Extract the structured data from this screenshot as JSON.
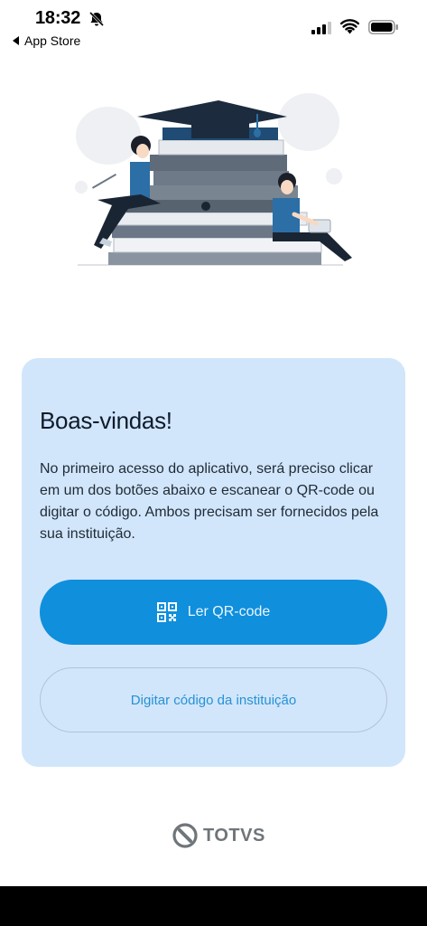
{
  "status_bar": {
    "time": "18:32",
    "back_label": "App Store"
  },
  "card": {
    "title": "Boas-vindas!",
    "description": "No primeiro acesso do aplicativo, será preciso clicar em um dos botões abaixo e escanear o QR-code ou digitar o código. Ambos precisam ser fornecidos pela sua instituição.",
    "qr_button_label": "Ler QR-code",
    "code_button_label": "Digitar código da instituição",
    "colors": {
      "background": "#d2e6fb",
      "primary": "#0f8fdc",
      "link": "#2592d4"
    }
  },
  "brand": {
    "name": "TOTVS"
  },
  "icons": [
    "bell-slash-icon",
    "back-arrow-icon",
    "signal-icon",
    "wifi-icon",
    "battery-icon",
    "qr-code-icon",
    "totvs-logo-icon"
  ]
}
